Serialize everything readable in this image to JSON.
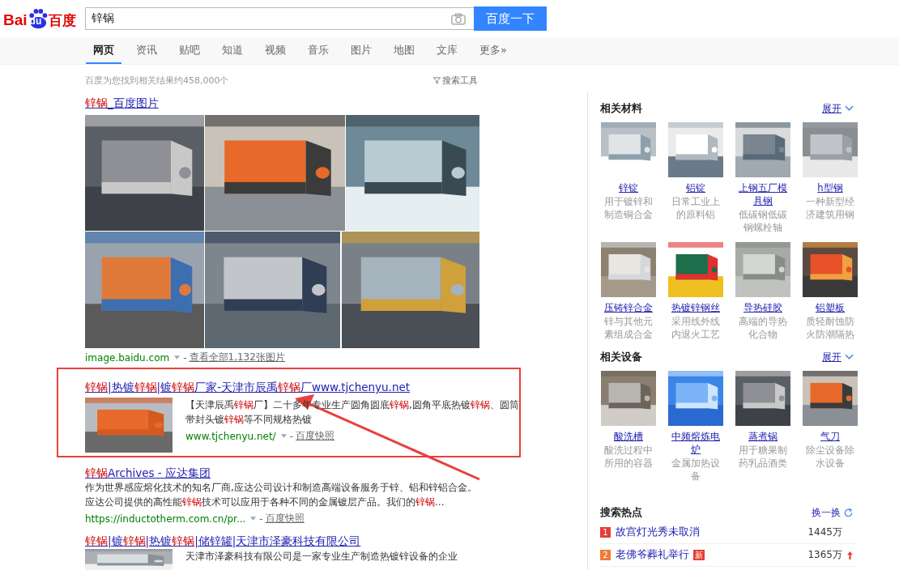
{
  "logo": {
    "left": "Bai",
    "paw": "du",
    "right": "百度"
  },
  "search": {
    "value": "锌锅",
    "button": "百度一下"
  },
  "tabs": [
    {
      "label": "网页",
      "selected": true
    },
    {
      "label": "资讯",
      "selected": false
    },
    {
      "label": "贴吧",
      "selected": false
    },
    {
      "label": "知道",
      "selected": false
    },
    {
      "label": "视频",
      "selected": false
    },
    {
      "label": "音乐",
      "selected": false
    },
    {
      "label": "图片",
      "selected": false
    },
    {
      "label": "地图",
      "selected": false
    },
    {
      "label": "文库",
      "selected": false
    },
    {
      "label": "更多»",
      "selected": false
    }
  ],
  "result_count": "百度为您找到相关结果约458,000个",
  "search_tools": "搜索工具",
  "results": [
    {
      "kind": "images",
      "boxed": false,
      "title": [
        {
          "text": "锌锅",
          "highlight": true
        },
        {
          "text": "_百度图片",
          "highlight": false
        }
      ],
      "images": [
        {
          "kind": "picture"
        },
        {
          "kind": "picture"
        },
        {
          "kind": "picture"
        },
        {
          "kind": "picture"
        },
        {
          "kind": "picture"
        },
        {
          "kind": "picture"
        }
      ],
      "url": "image.baidu.com",
      "separator": "-",
      "link": "查看全部1,132张图片"
    },
    {
      "kind": "thumb",
      "boxed": true,
      "title": [
        {
          "text": "锌锅",
          "highlight": true
        },
        {
          "text": "|热镀",
          "highlight": false
        },
        {
          "text": "锌锅",
          "highlight": true
        },
        {
          "text": "|镀",
          "highlight": false
        },
        {
          "text": "锌锅",
          "highlight": true
        },
        {
          "text": "厂家-天津市辰禹",
          "highlight": false
        },
        {
          "text": "锌锅",
          "highlight": true
        },
        {
          "text": "厂www.tjchenyu.net",
          "highlight": false
        }
      ],
      "snippet": [
        {
          "text": "【天津辰禹",
          "highlight": false
        },
        {
          "text": "锌锅",
          "highlight": true
        },
        {
          "text": "厂】二十多年专业生产圆角圆底",
          "highlight": false
        },
        {
          "text": "锌锅",
          "highlight": true
        },
        {
          "text": ",圆角平底热镀",
          "highlight": false
        },
        {
          "text": "锌锅",
          "highlight": true
        },
        {
          "text": "、圆筒带封头镀",
          "highlight": false
        },
        {
          "text": "锌锅",
          "highlight": true
        },
        {
          "text": "等不同规格热镀",
          "highlight": false
        }
      ],
      "url": "www.tjchenyu.net/",
      "separator": "-",
      "link": "百度快照"
    },
    {
      "kind": "text",
      "boxed": false,
      "title": [
        {
          "text": "锌锅",
          "highlight": true
        },
        {
          "text": "Archives - 应达集团",
          "highlight": false
        }
      ],
      "snippet": [
        {
          "text": "作为世界感应熔化技术的知名厂商,应达公司设计和制造高端设备服务于锌、铝和锌铝合金。应达公司提供的高性能",
          "highlight": false
        },
        {
          "text": "锌锅",
          "highlight": true
        },
        {
          "text": "技术可以应用于各种不同的金属镀层产品。我们的",
          "highlight": false
        },
        {
          "text": "锌锅",
          "highlight": true
        },
        {
          "text": "...",
          "highlight": false
        }
      ],
      "url": "https://inductotherm.com.cn/pr...",
      "separator": "-",
      "link": "百度快照"
    },
    {
      "kind": "thumb",
      "boxed": false,
      "title": [
        {
          "text": "锌锅",
          "highlight": true
        },
        {
          "text": "|镀",
          "highlight": false
        },
        {
          "text": "锌锅",
          "highlight": true
        },
        {
          "text": "|热镀",
          "highlight": false
        },
        {
          "text": "锌锅",
          "highlight": true
        },
        {
          "text": "|储锌罐|天津市泽豪科技有限公司",
          "highlight": false
        }
      ],
      "snippet": [
        {
          "text": "天津市泽豪科技有限公司是一家专业生产制造热镀锌设备的企业",
          "highlight": false
        }
      ]
    }
  ],
  "sidebar": [
    {
      "kind": "cards",
      "title": "相关材料",
      "action": "展开",
      "items": [
        {
          "name": "锌锭",
          "desc": "用于镀锌和制造铜合金"
        },
        {
          "name": "铝锭",
          "desc": "日常工业上的原料铝"
        },
        {
          "name": "上钢五厂模具钢",
          "desc": "低碳钢低碳钢螺栓轴"
        },
        {
          "name": "h型钢",
          "desc": "一种新型经济建筑用钢"
        },
        {
          "name": "压铸锌合金",
          "desc": "锌与其他元素组成合金"
        },
        {
          "name": "热镀锌钢丝",
          "desc": "采用线外线内退火工艺"
        },
        {
          "name": "导热硅胶",
          "desc": "高端的导热化合物"
        },
        {
          "name": "铝塑板",
          "desc": "质轻耐蚀防火防潮隔热"
        }
      ]
    },
    {
      "kind": "cards",
      "title": "相关设备",
      "action": "展开",
      "items": [
        {
          "name": "酸洗槽",
          "desc": "酸洗过程中所用的容器"
        },
        {
          "name": "中频熔炼电炉",
          "desc": "金属加热设备"
        },
        {
          "name": "蒸煮锅",
          "desc": "用于糖果制药乳品酒类"
        },
        {
          "name": "气刀",
          "desc": "除尘设备除水设备"
        }
      ]
    },
    {
      "kind": "hot",
      "title": "搜索热点",
      "action": "换一换",
      "items": [
        {
          "rank": "1",
          "color": "#e33e33",
          "text": "故宫灯光秀未取消",
          "count": "1445万",
          "rising": false
        },
        {
          "rank": "2",
          "color": "#f17a37",
          "text": "老佛爷葬礼举行",
          "badge": "新",
          "count": "1365万",
          "rising": true
        }
      ]
    }
  ]
}
